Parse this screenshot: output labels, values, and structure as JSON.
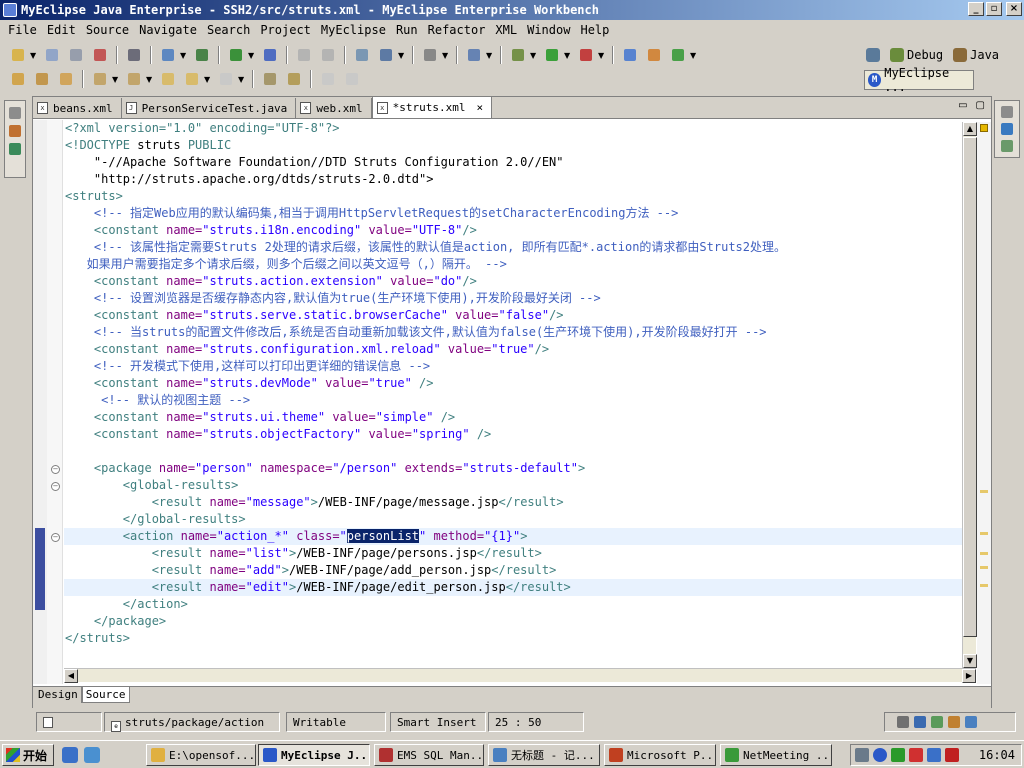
{
  "window": {
    "title": "MyEclipse Java Enterprise - SSH2/src/struts.xml - MyEclipse Enterprise Workbench",
    "minimize": "_",
    "maximize": "▫",
    "close": "×"
  },
  "menu": [
    "File",
    "Edit",
    "Source",
    "Navigate",
    "Search",
    "Project",
    "MyEclipse",
    "Run",
    "Refactor",
    "XML",
    "Window",
    "Help"
  ],
  "perspectives": {
    "debug": "Debug",
    "java": "Java",
    "active": "MyEclipse ..."
  },
  "editor_tabs": [
    {
      "label": "beans.xml",
      "icon": "x"
    },
    {
      "label": "PersonServiceTest.java",
      "icon": "J"
    },
    {
      "label": "web.xml",
      "icon": "x"
    },
    {
      "label": "*struts.xml",
      "icon": "x",
      "close": "×"
    }
  ],
  "code": {
    "l1": [
      "<?xml version=\"1.0\" encoding=\"UTF-8\"?>"
    ],
    "l2": [
      "<!DOCTYPE ",
      "struts",
      " PUBLIC"
    ],
    "l3": [
      "    \"-//Apache Software Foundation//DTD Struts Configuration 2.0//EN\""
    ],
    "l4": [
      "    \"http://struts.apache.org/dtds/struts-2.0.dtd\">"
    ],
    "l5": [
      "<struts>"
    ],
    "l6": [
      "    <!-- 指定Web应用的默认编码集,相当于调用HttpServletRequest的setCharacterEncoding方法 -->"
    ],
    "l7": [
      "    <constant ",
      "name=",
      "\"struts.i18n.encoding\"",
      " value=",
      "\"UTF-8\"",
      "/>"
    ],
    "l8": [
      "    <!-- 该属性指定需要Struts 2处理的请求后缀，该属性的默认值是action, 即所有匹配*.action的请求都由Struts2处理。"
    ],
    "l9": [
      "   如果用户需要指定多个请求后缀，则多个后缀之间以英文逗号（,）隔开。 -->"
    ],
    "l10": [
      "    <constant ",
      "name=",
      "\"struts.action.extension\"",
      " value=",
      "\"do\"",
      "/>"
    ],
    "l11": [
      "    <!-- 设置浏览器是否缓存静态内容,默认值为true(生产环境下使用),开发阶段最好关闭 -->"
    ],
    "l12": [
      "    <constant ",
      "name=",
      "\"struts.serve.static.browserCache\"",
      " value=",
      "\"false\"",
      "/>"
    ],
    "l13": [
      "    <!-- 当struts的配置文件修改后,系统是否自动重新加载该文件,默认值为false(生产环境下使用),开发阶段最好打开 -->"
    ],
    "l14": [
      "    <constant ",
      "name=",
      "\"struts.configuration.xml.reload\"",
      " value=",
      "\"true\"",
      "/>"
    ],
    "l15": [
      "    <!-- 开发模式下使用,这样可以打印出更详细的错误信息 -->"
    ],
    "l16": [
      "    <constant ",
      "name=",
      "\"struts.devMode\"",
      " value=",
      "\"true\"",
      " />"
    ],
    "l17": [
      "     <!-- 默认的视图主题 -->"
    ],
    "l18": [
      "    <constant ",
      "name=",
      "\"struts.ui.theme\"",
      " value=",
      "\"simple\"",
      " />"
    ],
    "l19": [
      "    <constant ",
      "name=",
      "\"struts.objectFactory\"",
      " value=",
      "\"spring\"",
      " />"
    ],
    "l20": [
      ""
    ],
    "l21": [
      "    <package ",
      "name=",
      "\"person\"",
      " namespace=",
      "\"/person\"",
      " extends=",
      "\"struts-default\"",
      ">"
    ],
    "l22": [
      "        <global-results>"
    ],
    "l23": [
      "            <result ",
      "name=",
      "\"message\"",
      ">",
      "/WEB-INF/page/message.jsp",
      "</result>"
    ],
    "l24": [
      "        </global-results>"
    ],
    "l25": [
      "        <action ",
      "name=",
      "\"action_*\"",
      " class=",
      "\"",
      "personList",
      "\"",
      " method=",
      "\"{1}\"",
      ">"
    ],
    "l26": [
      "            <result ",
      "name=",
      "\"list\"",
      ">",
      "/WEB-INF/page/persons.jsp",
      "</result>"
    ],
    "l27": [
      "            <result ",
      "name=",
      "\"add\"",
      ">",
      "/WEB-INF/page/add_person.jsp",
      "</result>"
    ],
    "l28": [
      "            <result ",
      "name=",
      "\"edit\"",
      ">",
      "/WEB-INF/page/edit_person.jsp",
      "</result>"
    ],
    "l29": [
      "        </action>"
    ],
    "l30": [
      "    </package>"
    ],
    "l31": [
      "</struts>"
    ]
  },
  "editor_bottom_tabs": [
    "Design",
    "Source"
  ],
  "status": {
    "breadcrumb": "struts/package/action",
    "writable": "Writable",
    "insert_mode": "Smart Insert",
    "position": "25 : 50"
  },
  "taskbar": {
    "start": "开始",
    "items": [
      {
        "label": "E:\\opensof...",
        "color": "#e0b040"
      },
      {
        "label": "MyEclipse J...",
        "color": "#2a58c8"
      },
      {
        "label": "EMS SQL Man...",
        "color": "#b03030"
      },
      {
        "label": "无标题 - 记...",
        "color": "#4a80c0"
      },
      {
        "label": "Microsoft P...",
        "color": "#c04020"
      },
      {
        "label": "NetMeeting ...",
        "color": "#3a9a3a"
      }
    ],
    "clock": "16:04"
  }
}
